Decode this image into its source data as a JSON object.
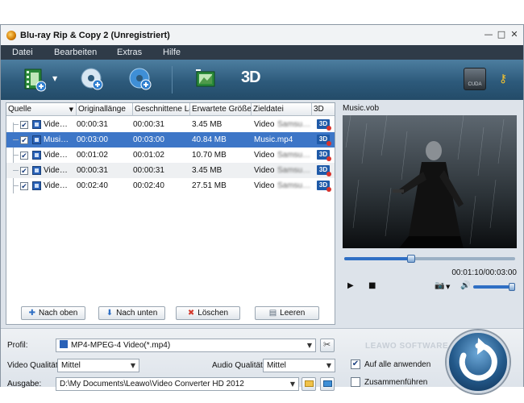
{
  "window": {
    "title": "Blu-ray Rip & Copy 2 (Unregistriert)",
    "controls": [
      "—",
      "□",
      "✕"
    ]
  },
  "menu": [
    "Datei",
    "Bearbeiten",
    "Extras",
    "Hilfe"
  ],
  "toolbar": {
    "three_d_label": "3D",
    "cuda_label": "CUDA"
  },
  "table": {
    "columns": [
      "Quelle",
      "Originallänge",
      "Geschnittene Lä",
      "Erwartete Größe",
      "Zieldatei",
      "3D"
    ],
    "rows": [
      {
        "source": "Vide…",
        "original": "00:00:31",
        "cut": "00:00:31",
        "size": "3.45 MB",
        "target": "Video",
        "target_blur": "Samsu…",
        "checked": true
      },
      {
        "source": "Musi…",
        "original": "00:03:00",
        "cut": "00:03:00",
        "size": "40.84 MB",
        "target": "Music.mp4",
        "target_blur": "",
        "checked": true
      },
      {
        "source": "Vide…",
        "original": "00:01:02",
        "cut": "00:01:02",
        "size": "10.70 MB",
        "target": "Video",
        "target_blur": "Samsu…",
        "checked": true
      },
      {
        "source": "Vide…",
        "original": "00:00:31",
        "cut": "00:00:31",
        "size": "3.45 MB",
        "target": "Video",
        "target_blur": "Samsu…",
        "checked": true
      },
      {
        "source": "Vide…",
        "original": "00:02:40",
        "cut": "00:02:40",
        "size": "27.51 MB",
        "target": "Video",
        "target_blur": "Samsu…",
        "checked": true
      }
    ],
    "badge_label": "3D"
  },
  "list_buttons": {
    "up": "Nach oben",
    "down": "Nach unten",
    "delete": "Löschen",
    "clear": "Leeren"
  },
  "preview": {
    "filename": "Music.vob",
    "time": "00:01:10/00:03:00",
    "progress": 0.39,
    "volume": 1.0
  },
  "bottom": {
    "profile_label": "Profil:",
    "profile_value": "MP4-MPEG-4 Video(*.mp4)",
    "video_quality_label": "Video Qualität:",
    "video_quality_value": "Mittel",
    "audio_quality_label": "Audio Qualität:",
    "audio_quality_value": "Mittel",
    "output_label": "Ausgabe:",
    "output_value": "D:\\My Documents\\Leawo\\Video Converter HD 2012",
    "apply_all_label": "Auf alle anwenden",
    "apply_all_checked": true,
    "merge_label": "Zusammenführen",
    "merge_checked": false,
    "brand": "LEAWO SOFTWARE"
  },
  "colors": {
    "menubar": "#2f3b48",
    "toolbar": "#2d5a7b",
    "selected_row": "#3d76c7",
    "accent": "#2f6fc4"
  }
}
